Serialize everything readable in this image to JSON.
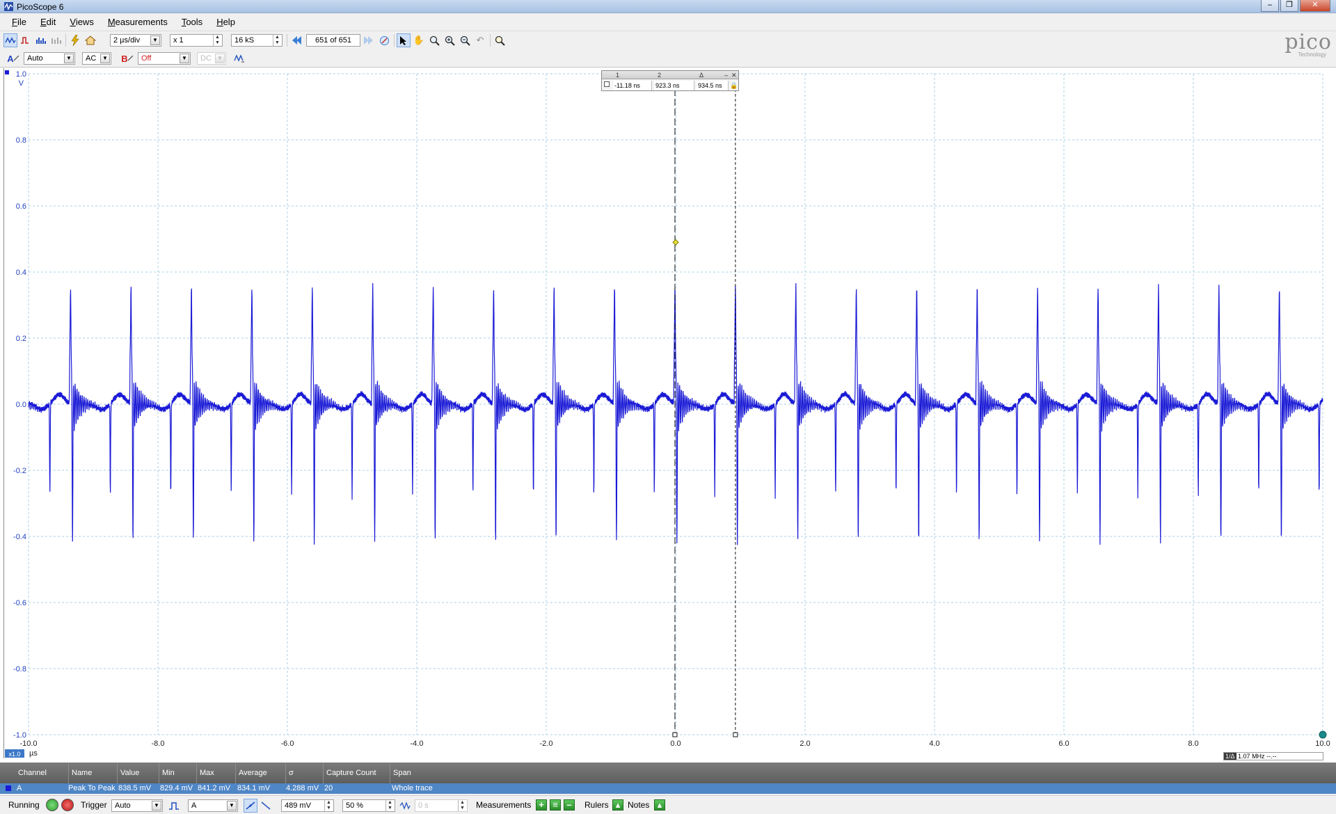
{
  "window": {
    "title": "PicoScope 6",
    "controls": [
      "–",
      "❐",
      "✕"
    ]
  },
  "menu": [
    {
      "label": "File",
      "ul": "F",
      "rest": "ile"
    },
    {
      "label": "Edit",
      "ul": "E",
      "rest": "dit"
    },
    {
      "label": "Views",
      "ul": "V",
      "rest": "iews"
    },
    {
      "label": "Measurements",
      "ul": "M",
      "rest": "easurements"
    },
    {
      "label": "Tools",
      "ul": "T",
      "rest": "ools"
    },
    {
      "label": "Help",
      "ul": "H",
      "rest": "elp"
    }
  ],
  "toolbar": {
    "timebase": "2 µs/div",
    "multiplier": "x 1",
    "samples": "16 kS",
    "buffer": "651 of 651"
  },
  "channels": {
    "a_label": "A",
    "a_range": "Auto",
    "a_coupling": "AC",
    "b_label": "B",
    "b_range": "Off",
    "b_coupling": "DC"
  },
  "logo": {
    "word": "pico",
    "sub": "Technology"
  },
  "chart_data": {
    "type": "line",
    "xlabel": "µs",
    "ylabel": "V",
    "xlim": [
      -10.0,
      10.0
    ],
    "ylim": [
      -1.0,
      1.0
    ],
    "x_ticks": [
      "-10.0",
      "-8.0",
      "-6.0",
      "-4.0",
      "-2.0",
      "0.0",
      "2.0",
      "4.0",
      "6.0",
      "8.0",
      "10.0"
    ],
    "y_ticks": [
      "1.0",
      "0.8",
      "0.6",
      "0.4",
      "0.2",
      "0.0",
      "-0.2",
      "-0.4",
      "-0.6",
      "-0.8",
      "-1.0"
    ],
    "grid": true,
    "scale_badge": "x1.0",
    "series": [
      {
        "color": "#1a1ad6",
        "period_us": 0.934,
        "first_spike_us": -9.35,
        "spike_max_v": 0.47,
        "spike_min_v": -0.33,
        "pre_dip_v": -0.28,
        "baseline_v": 0.0,
        "ripple_v": 0.03
      }
    ],
    "rulers": [
      {
        "name": "1",
        "x": -0.01118
      },
      {
        "name": "2",
        "x": 0.9233
      }
    ],
    "trigger_marker": {
      "x": 0.0,
      "y": 0.49
    }
  },
  "rulers_box": {
    "headers": [
      "1",
      "2",
      "Δ"
    ],
    "values": [
      "-11.18 ns",
      "923.3 ns",
      "934.5 ns"
    ]
  },
  "freq_readout": {
    "label": "1/Δ",
    "value": "1.07 MHz",
    "extra": "--.--"
  },
  "measurements": {
    "headers": [
      "Channel",
      "Name",
      "Value",
      "Min",
      "Max",
      "Average",
      "σ",
      "Capture Count",
      "Span"
    ],
    "row": [
      "A",
      "Peak To Peak",
      "838.5 mV",
      "829.4 mV",
      "841.2 mV",
      "834.1 mV",
      "4.288 mV",
      "20",
      "Whole trace"
    ]
  },
  "status": {
    "running": "Running",
    "trigger_label": "Trigger",
    "trigger_mode": "Auto",
    "trigger_source": "A",
    "threshold": "489 mV",
    "pre_trigger": "50 %",
    "delay": "0 s",
    "measurements_label": "Measurements",
    "rulers_label": "Rulers",
    "notes_label": "Notes"
  }
}
